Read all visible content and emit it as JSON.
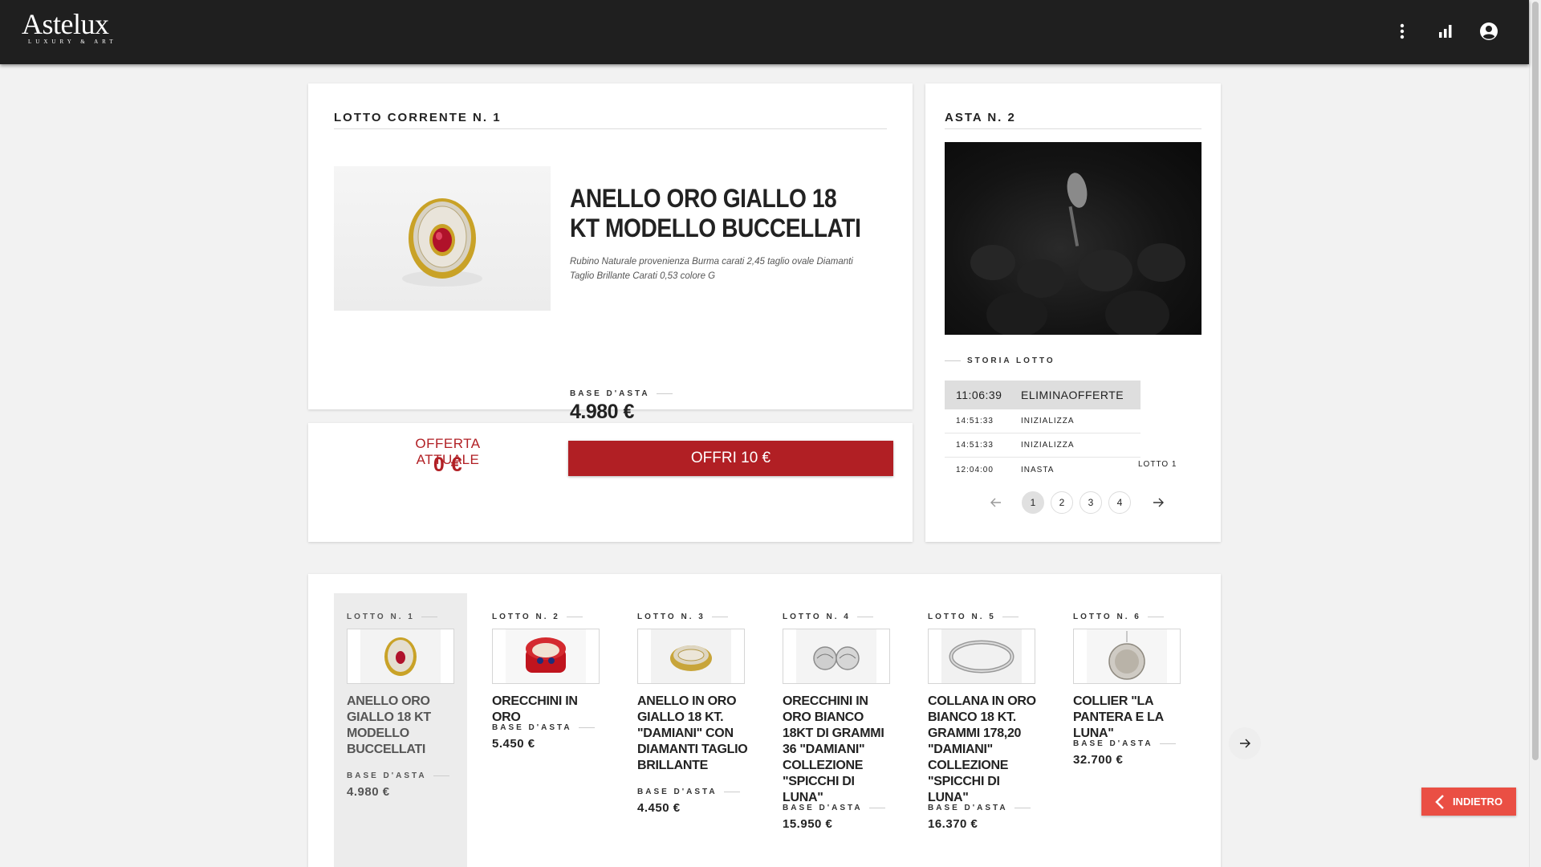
{
  "brand": {
    "name": "Astelux",
    "tagline": "LUXURY & ART"
  },
  "topbar": {
    "icons": [
      "more-vert-icon",
      "bar-chart-icon",
      "account-circle-icon"
    ]
  },
  "current_lot": {
    "title": "LOTTO CORRENTE N. 1",
    "name": "ANELLO ORO GIALLO 18 KT MODELLO BUCCELLATI",
    "description": "Rubino Naturale provenienza Burma carati 2,45 taglio ovale Diamanti Taglio Brillante Carati 0,53 colore G",
    "base_label": "BASE D'ASTA",
    "base_value": "4.980 €"
  },
  "offer": {
    "label": "OFFERTA ATTUALE",
    "value": "0 €",
    "button": "OFFRI 10 €"
  },
  "auction": {
    "title": "ASTA N. 2",
    "history_label": "STORIA LOTTO",
    "history": [
      {
        "time": "11:06:39",
        "action": "ELIMINAOFFERTE"
      },
      {
        "time": "14:51:33",
        "action": "INIZIALIZZA"
      },
      {
        "time": "14:51:33",
        "action": "INIZIALIZZA"
      },
      {
        "time": "12:04:00",
        "action": "INASTA"
      }
    ],
    "history_lot": "LOTTO 1",
    "pages": [
      "1",
      "2",
      "3",
      "4"
    ],
    "active_page": "1"
  },
  "lots": [
    {
      "label": "LOTTO N. 1",
      "name": "ANELLO ORO GIALLO 18 KT MODELLO BUCCELLATI",
      "base_label": "BASE D'ASTA",
      "base_value": "4.980 €"
    },
    {
      "label": "LOTTO N. 2",
      "name": "ORECCHINI IN ORO",
      "base_label": "BASE D'ASTA",
      "base_value": "5.450 €"
    },
    {
      "label": "LOTTO N. 3",
      "name": "ANELLO IN ORO GIALLO 18 KT. \"DAMIANI\" CON DIAMANTI TAGLIO BRILLANTE",
      "base_label": "BASE D'ASTA",
      "base_value": "4.450 €"
    },
    {
      "label": "LOTTO N. 4",
      "name": "ORECCHINI IN ORO BIANCO 18KT DI GRAMMI 36 \"DAMIANI\" COLLEZIONE \"SPICCHI DI LUNA\"",
      "base_label": "BASE D'ASTA",
      "base_value": "15.950 €"
    },
    {
      "label": "LOTTO N. 5",
      "name": "COLLANA IN ORO BIANCO 18 KT. GRAMMI 178,20 \"DAMIANI\" COLLEZIONE \"SPICCHI DI LUNA\"",
      "base_label": "BASE D'ASTA",
      "base_value": "16.370 €"
    },
    {
      "label": "LOTTO N. 6",
      "name": "COLLIER \"LA PANTERA E LA LUNA\"",
      "base_label": "BASE D'ASTA",
      "base_value": "32.700 €"
    }
  ],
  "back_button": "INDIETRO",
  "colors": {
    "accent": "#b11f24",
    "back": "#ea4f44",
    "topbar": "#1f1f1f"
  }
}
